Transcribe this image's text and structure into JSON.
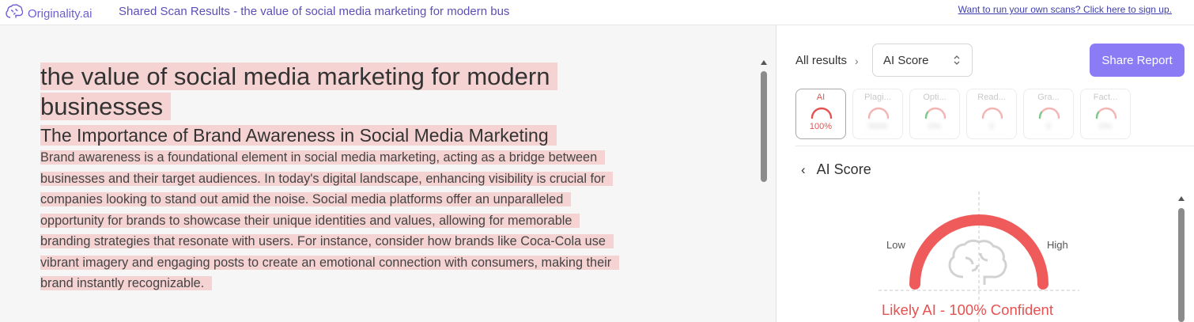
{
  "header": {
    "logo_text": "Originality.ai",
    "page_title": "Shared Scan Results - the value of social media marketing for modern bus",
    "signup_link": "Want to run your own scans? Click here to sign up."
  },
  "document": {
    "title_line1": "the value of social media marketing for modern",
    "title_line2": "businesses",
    "heading": "The Importance of Brand Awareness in Social Media Marketing",
    "paragraph_lines": [
      "Brand awareness is a foundational element in social media marketing, acting as a bridge between",
      "businesses and their target audiences. In today's digital landscape, enhancing visibility is crucial for",
      "companies looking to stand out amid the noise. Social media platforms offer an unparalleled",
      "opportunity for brands to showcase their unique identities and values, allowing for memorable",
      "branding strategies that resonate with users. For instance, consider how brands like Coca-Cola use",
      "vibrant imagery and engaging posts to create an emotional connection with consumers, making their",
      "brand instantly recognizable."
    ],
    "highlight_color": "#f6d3d3"
  },
  "results": {
    "breadcrumb": "All results",
    "selected_view": "AI Score",
    "share_button": "Share Report",
    "tabs": [
      {
        "label": "AI",
        "value": "100%",
        "active": true,
        "color": "#e55252"
      },
      {
        "label": "Plagi...",
        "value": "0000",
        "active": false,
        "color": "#f3b4b4"
      },
      {
        "label": "Opti...",
        "value": "0%",
        "active": false,
        "color": "#f3b4b4"
      },
      {
        "label": "Read...",
        "value": "0",
        "active": false,
        "color": "#f3b4b4"
      },
      {
        "label": "Gra...",
        "value": "0",
        "active": false,
        "color": "#f3b4b4"
      },
      {
        "label": "Fact...",
        "value": "0%",
        "active": false,
        "color": "#f3b4b4"
      }
    ],
    "section_title": "AI Score",
    "gauge": {
      "low_label": "Low",
      "high_label": "High",
      "score_percent": 100,
      "color": "#ef5b5b"
    },
    "verdict": "Likely AI - 100% Confident"
  },
  "colors": {
    "accent": "#8b7cf6",
    "ai_red": "#e55252"
  }
}
